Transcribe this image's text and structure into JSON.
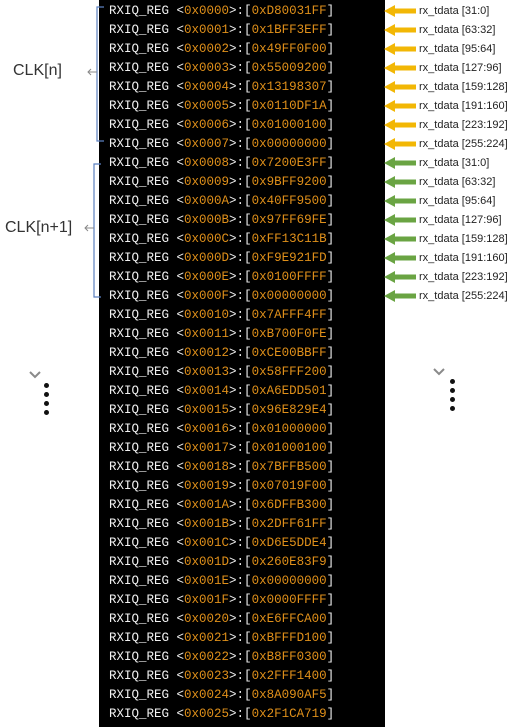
{
  "registers": [
    {
      "name": "RXIQ_REG",
      "addr": "0x0000",
      "value": "0xD80031FF"
    },
    {
      "name": "RXIQ_REG",
      "addr": "0x0001",
      "value": "0x1BFF3EFF"
    },
    {
      "name": "RXIQ_REG",
      "addr": "0x0002",
      "value": "0x49FF0F00"
    },
    {
      "name": "RXIQ_REG",
      "addr": "0x0003",
      "value": "0x55009200"
    },
    {
      "name": "RXIQ_REG",
      "addr": "0x0004",
      "value": "0x13198307"
    },
    {
      "name": "RXIQ_REG",
      "addr": "0x0005",
      "value": "0x0110DF1A"
    },
    {
      "name": "RXIQ_REG",
      "addr": "0x0006",
      "value": "0x01000100"
    },
    {
      "name": "RXIQ_REG",
      "addr": "0x0007",
      "value": "0x00000000"
    },
    {
      "name": "RXIQ_REG",
      "addr": "0x0008",
      "value": "0x7200E3FF"
    },
    {
      "name": "RXIQ_REG",
      "addr": "0x0009",
      "value": "0x9BFF9200"
    },
    {
      "name": "RXIQ_REG",
      "addr": "0x000A",
      "value": "0x40FF9500"
    },
    {
      "name": "RXIQ_REG",
      "addr": "0x000B",
      "value": "0x97FF69FE"
    },
    {
      "name": "RXIQ_REG",
      "addr": "0x000C",
      "value": "0xFF13C11B"
    },
    {
      "name": "RXIQ_REG",
      "addr": "0x000D",
      "value": "0xF9E921FD"
    },
    {
      "name": "RXIQ_REG",
      "addr": "0x000E",
      "value": "0x0100FFFF"
    },
    {
      "name": "RXIQ_REG",
      "addr": "0x000F",
      "value": "0x00000000"
    },
    {
      "name": "RXIQ_REG",
      "addr": "0x0010",
      "value": "0x7AFFF4FF"
    },
    {
      "name": "RXIQ_REG",
      "addr": "0x0011",
      "value": "0xB700F0FE"
    },
    {
      "name": "RXIQ_REG",
      "addr": "0x0012",
      "value": "0xCE00BBFF"
    },
    {
      "name": "RXIQ_REG",
      "addr": "0x0013",
      "value": "0x58FFF200"
    },
    {
      "name": "RXIQ_REG",
      "addr": "0x0014",
      "value": "0xA6EDD501"
    },
    {
      "name": "RXIQ_REG",
      "addr": "0x0015",
      "value": "0x96E829E4"
    },
    {
      "name": "RXIQ_REG",
      "addr": "0x0016",
      "value": "0x01000000"
    },
    {
      "name": "RXIQ_REG",
      "addr": "0x0017",
      "value": "0x01000100"
    },
    {
      "name": "RXIQ_REG",
      "addr": "0x0018",
      "value": "0x7BFFB500"
    },
    {
      "name": "RXIQ_REG",
      "addr": "0x0019",
      "value": "0x07019F00"
    },
    {
      "name": "RXIQ_REG",
      "addr": "0x001A",
      "value": "0x6DFFB300"
    },
    {
      "name": "RXIQ_REG",
      "addr": "0x001B",
      "value": "0x2DFF61FF"
    },
    {
      "name": "RXIQ_REG",
      "addr": "0x001C",
      "value": "0xD6E5DDE4"
    },
    {
      "name": "RXIQ_REG",
      "addr": "0x001D",
      "value": "0x260E83F9"
    },
    {
      "name": "RXIQ_REG",
      "addr": "0x001E",
      "value": "0x00000000"
    },
    {
      "name": "RXIQ_REG",
      "addr": "0x001F",
      "value": "0x0000FFFF"
    },
    {
      "name": "RXIQ_REG",
      "addr": "0x0020",
      "value": "0xE6FFCA00"
    },
    {
      "name": "RXIQ_REG",
      "addr": "0x0021",
      "value": "0xBFFFD100"
    },
    {
      "name": "RXIQ_REG",
      "addr": "0x0022",
      "value": "0xB8FF0300"
    },
    {
      "name": "RXIQ_REG",
      "addr": "0x0023",
      "value": "0x2FFF1400"
    },
    {
      "name": "RXIQ_REG",
      "addr": "0x0024",
      "value": "0x8A090AF5"
    },
    {
      "name": "RXIQ_REG",
      "addr": "0x0025",
      "value": "0x2F1CA719"
    }
  ],
  "clk_groups": [
    {
      "label": "CLK[n]",
      "arrow_color": "#f2b705",
      "annotations": [
        "rx_tdata [31:0]",
        "rx_tdata [63:32]",
        "rx_tdata [95:64]",
        "rx_tdata [127:96]",
        "rx_tdata [159:128]",
        "rx_tdata [191:160]",
        "rx_tdata [223:192]",
        "rx_tdata [255:224]"
      ]
    },
    {
      "label": "CLK[n+1]",
      "arrow_color": "#6aa443",
      "annotations": [
        "rx_tdata [31:0]",
        "rx_tdata [63:32]",
        "rx_tdata [95:64]",
        "rx_tdata [127:96]",
        "rx_tdata [159:128]",
        "rx_tdata [191:160]",
        "rx_tdata [223:192]",
        "rx_tdata [255:224]"
      ]
    }
  ],
  "colors": {
    "terminal_bg": "#000000",
    "register_name": "#f2f2f2",
    "register_value": "#e0901a",
    "bracket_line": "#5b7fbf"
  },
  "icons": [
    "chevron-down-icon",
    "vertical-ellipsis-icon"
  ]
}
